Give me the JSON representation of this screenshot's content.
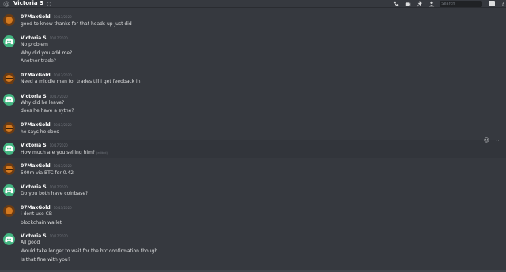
{
  "header": {
    "channel_title": "Victoria S",
    "search_placeholder": "Search",
    "help_label": "?"
  },
  "messages": [
    {
      "author": "07MaxGold",
      "avatar": "orange-ball-avatar",
      "time": "10/17/2020",
      "lines": [
        "good to know thanks for that heads up just did"
      ]
    },
    {
      "author": "Victoria S",
      "avatar": "discord-default-avatar",
      "time": "10/17/2020",
      "lines": [
        "No problem",
        "Why did you add me?",
        "Another trade?"
      ]
    },
    {
      "author": "07MaxGold",
      "avatar": "orange-ball-avatar",
      "time": "10/17/2020",
      "lines": [
        "Need a middle man for trades till i get feedback in"
      ]
    },
    {
      "author": "Victoria S",
      "avatar": "discord-default-avatar",
      "time": "10/17/2020",
      "lines": [
        "Why did he leave?",
        "does he have a sythe?"
      ]
    },
    {
      "author": "07MaxGold",
      "avatar": "orange-ball-avatar",
      "time": "10/17/2020",
      "lines": [
        "he says he does"
      ]
    },
    {
      "author": "Victoria S",
      "avatar": "discord-default-avatar",
      "time": "10/17/2020",
      "lines": [
        "How much are you selling him?"
      ],
      "edited": "(edited)"
    },
    {
      "author": "07MaxGold",
      "avatar": "orange-ball-avatar",
      "time": "10/17/2020",
      "lines": [
        "500m via BTC for 0.42"
      ]
    },
    {
      "author": "Victoria S",
      "avatar": "discord-default-avatar",
      "time": "10/17/2020",
      "lines": [
        "Do you both have coinbase?"
      ]
    },
    {
      "author": "07MaxGold",
      "avatar": "orange-ball-avatar",
      "time": "10/17/2020",
      "lines": [
        "i dont use CB",
        "blockchain wallet"
      ]
    },
    {
      "author": "Victoria S",
      "avatar": "discord-default-avatar",
      "time": "10/17/2020",
      "lines": [
        "All good",
        "Would take longer to wait for the btc confirmation though",
        "Is that fine with you?"
      ]
    }
  ],
  "hover_actions": {
    "reaction_icon": "☺",
    "more_icon": "⋯"
  },
  "colors": {
    "background": "#36393f",
    "accent_green": "#43b581",
    "username": "#ffffff",
    "text": "#dcddde",
    "timestamp": "#72767d"
  }
}
